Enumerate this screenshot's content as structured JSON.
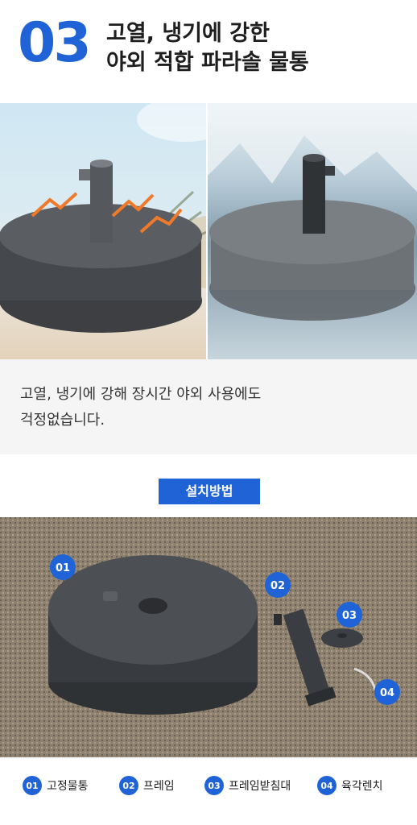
{
  "header": {
    "number": "03",
    "title_line1": "고열, 냉기에 강한",
    "title_line2": "야외 적합 파라솔 물통"
  },
  "description": {
    "line1": "고열, 냉기에 강해 장시간 야외 사용에도",
    "line2": "걱정없습니다."
  },
  "install": {
    "badge": "설치방법",
    "markers": [
      "01",
      "02",
      "03",
      "04"
    ]
  },
  "legend": [
    {
      "num": "01",
      "label": "고정물통"
    },
    {
      "num": "02",
      "label": "프레임"
    },
    {
      "num": "03",
      "label": "프레임받침대"
    },
    {
      "num": "04",
      "label": "육각렌치"
    }
  ],
  "colors": {
    "accent": "#1f63d6",
    "heat_arrow": "#f07a2a",
    "base_gray": "#4f5256"
  }
}
